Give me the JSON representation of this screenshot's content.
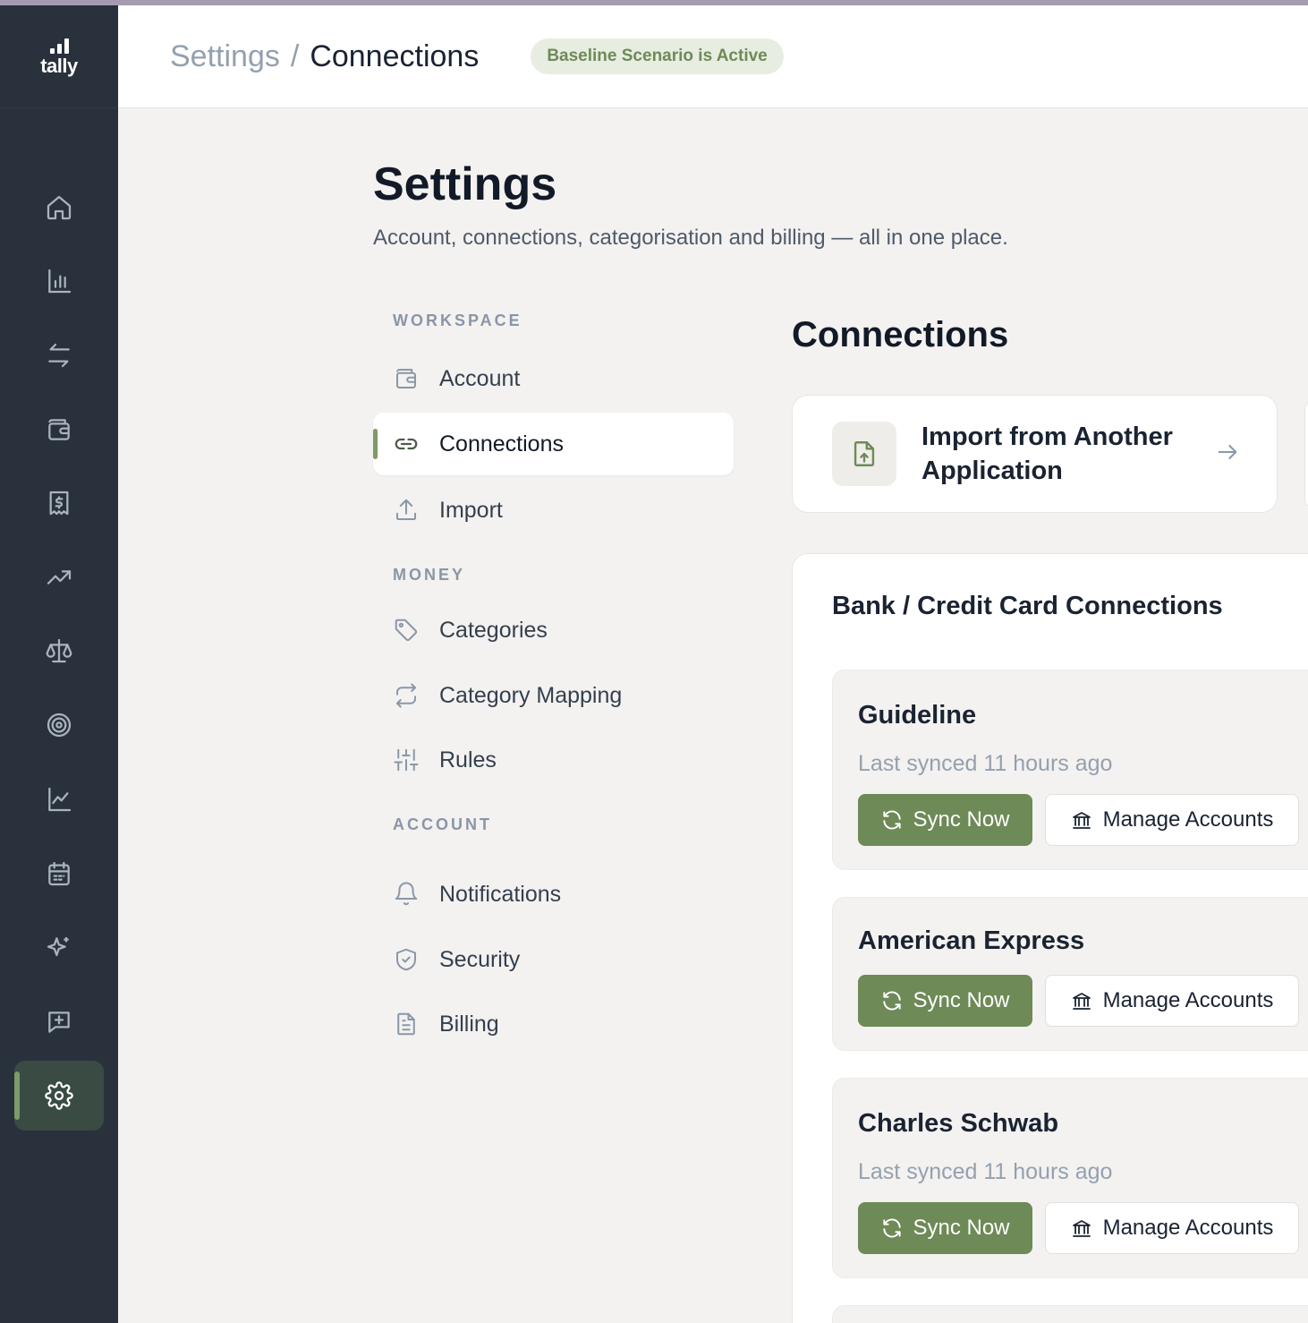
{
  "app": {
    "logo_text": "tally"
  },
  "rail": {
    "items": [
      {
        "icon": "home-icon"
      },
      {
        "icon": "bar-chart-icon"
      },
      {
        "icon": "transfer-icon"
      },
      {
        "icon": "wallet-icon"
      },
      {
        "icon": "receipt-dollar-icon"
      },
      {
        "icon": "trending-up-icon"
      },
      {
        "icon": "scale-icon"
      },
      {
        "icon": "target-icon"
      },
      {
        "icon": "line-chart-icon"
      },
      {
        "icon": "calendar-icon"
      },
      {
        "icon": "sparkles-icon"
      },
      {
        "icon": "message-plus-icon"
      },
      {
        "icon": "gear-icon",
        "active": true
      }
    ]
  },
  "header": {
    "breadcrumb_root": "Settings",
    "breadcrumb_sep": "/",
    "breadcrumb_current": "Connections",
    "scenario_badge": "Baseline Scenario is Active"
  },
  "page": {
    "title": "Settings",
    "subtitle": "Account, connections, categorisation and billing — all in one place."
  },
  "settings_nav": {
    "sections": [
      {
        "label": "WORKSPACE",
        "items": [
          {
            "label": "Account",
            "icon": "wallet-icon"
          },
          {
            "label": "Connections",
            "icon": "link-icon",
            "active": true
          },
          {
            "label": "Import",
            "icon": "upload-icon"
          }
        ]
      },
      {
        "label": "MONEY",
        "items": [
          {
            "label": "Categories",
            "icon": "tag-icon"
          },
          {
            "label": "Category Mapping",
            "icon": "repeat-icon"
          },
          {
            "label": "Rules",
            "icon": "sliders-icon"
          }
        ]
      },
      {
        "label": "ACCOUNT",
        "items": [
          {
            "label": "Notifications",
            "icon": "bell-icon"
          },
          {
            "label": "Security",
            "icon": "shield-check-icon"
          },
          {
            "label": "Billing",
            "icon": "file-text-icon"
          }
        ]
      }
    ]
  },
  "content": {
    "title": "Connections",
    "import_card": {
      "label": "Import from Another Application",
      "icon": "file-upload-icon"
    },
    "bank_section": {
      "title": "Bank / Credit Card Connections",
      "connections": [
        {
          "name": "Guideline",
          "last_synced": "Last synced 11 hours ago",
          "sync_label": "Sync Now",
          "manage_label": "Manage Accounts"
        },
        {
          "name": "American Express",
          "sync_label": "Sync Now",
          "manage_label": "Manage Accounts"
        },
        {
          "name": "Charles Schwab",
          "last_synced": "Last synced 11 hours ago",
          "sync_label": "Sync Now",
          "manage_label": "Manage Accounts"
        }
      ]
    }
  },
  "colors": {
    "rail_bg": "#28313c",
    "accent_green": "#6e8a57",
    "badge_bg": "#e7ede0",
    "page_bg": "#f3f2f0"
  }
}
